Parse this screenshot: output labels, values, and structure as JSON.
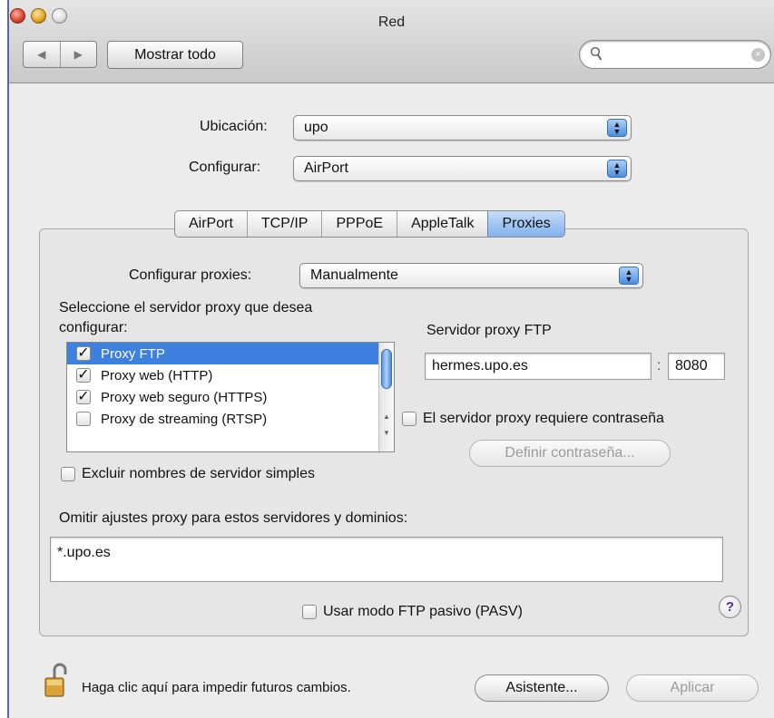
{
  "window": {
    "title": "Red"
  },
  "toolbar": {
    "back_glyph": "◀",
    "forward_glyph": "▶",
    "show_all_label": "Mostrar todo",
    "search_placeholder": "",
    "search_value": ""
  },
  "location": {
    "label": "Ubicación:",
    "value": "upo"
  },
  "configure": {
    "label": "Configurar:",
    "value": "AirPort"
  },
  "tabs": [
    {
      "label": "AirPort",
      "active": false
    },
    {
      "label": "TCP/IP",
      "active": false
    },
    {
      "label": "PPPoE",
      "active": false
    },
    {
      "label": "AppleTalk",
      "active": false
    },
    {
      "label": "Proxies",
      "active": true
    }
  ],
  "proxies": {
    "configure_label": "Configurar proxies:",
    "configure_value": "Manualmente",
    "select_label_line1": "Seleccione el servidor proxy que desea",
    "select_label_line2": "configurar:",
    "list": [
      {
        "label": "Proxy FTP",
        "checked": true,
        "selected": true
      },
      {
        "label": "Proxy web (HTTP)",
        "checked": true,
        "selected": false
      },
      {
        "label": "Proxy web seguro (HTTPS)",
        "checked": true,
        "selected": false
      },
      {
        "label": "Proxy de streaming (RTSP)",
        "checked": false,
        "selected": false
      }
    ],
    "server_label": "Servidor proxy FTP",
    "server_value": "hermes.upo.es",
    "port_separator": ":",
    "port_value": "8080",
    "password_required_label": "El servidor proxy requiere contraseña",
    "set_password_label": "Definir contraseña...",
    "exclude_simple_label": "Excluir nombres de servidor simples",
    "bypass_label": "Omitir ajustes proxy para estos servidores y dominios:",
    "bypass_value": "*.upo.es",
    "passive_ftp_label": "Usar modo FTP pasivo (PASV)",
    "help_glyph": "?"
  },
  "footer": {
    "lock_text": "Haga clic aquí para impedir futuros cambios.",
    "assistant_label": "Asistente...",
    "apply_label": "Aplicar"
  },
  "colors": {
    "selection": "#3d80df",
    "active_tab": "#7fb1ec",
    "window_bg": "#ececec"
  }
}
